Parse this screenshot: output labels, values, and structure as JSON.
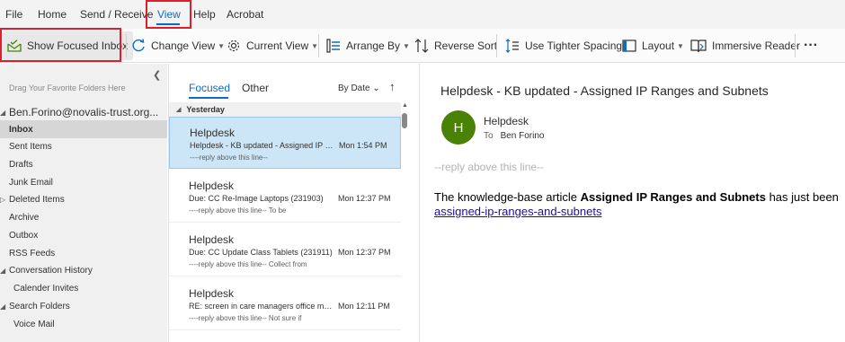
{
  "menu": {
    "items": [
      "File",
      "Home",
      "Send / Receive",
      "View",
      "Help",
      "Acrobat"
    ],
    "active": "View"
  },
  "ribbon": {
    "show_focused_inbox": "Show Focused Inbox",
    "change_view": "Change View",
    "current_view": "Current View",
    "arrange_by": "Arrange By",
    "reverse_sort": "Reverse Sort",
    "tighter_spacing": "Use Tighter Spacing",
    "layout": "Layout",
    "immersive_reader": "Immersive Reader",
    "more": "···"
  },
  "folders": {
    "favorites_hint": "Drag Your Favorite Folders Here",
    "account": "Ben.Forino@novalis-trust.org...",
    "items": [
      "Inbox",
      "Sent Items",
      "Drafts",
      "Junk Email",
      "Deleted Items",
      "Archive",
      "Outbox",
      "RSS Feeds",
      "Conversation History",
      "Calender Invites",
      "Search Folders",
      "Voice Mail"
    ],
    "selected": "Inbox"
  },
  "message_list": {
    "tab_focused": "Focused",
    "tab_other": "Other",
    "sort_label": "By Date",
    "group": "Yesterday",
    "messages": [
      {
        "from": "Helpdesk",
        "subject": "Helpdesk - KB updated - Assigned IP Ra...",
        "time": "Mon 1:54 PM",
        "preview": "----reply above this line--"
      },
      {
        "from": "Helpdesk",
        "subject": "Due: CC Re-Image Laptops (231903)",
        "time": "Mon 12:37 PM",
        "preview": "----reply above this line--  To be"
      },
      {
        "from": "Helpdesk",
        "subject": "Due: CC Update Class Tablets (231911)",
        "time": "Mon 12:37 PM",
        "preview": "----reply above this line--  Collect from"
      },
      {
        "from": "Helpdesk",
        "subject": "RE: screen in care managers office mul...",
        "time": "Mon 12:11 PM",
        "preview": "----reply above this line--  Not sure if"
      }
    ]
  },
  "reading": {
    "subject": "Helpdesk - KB updated - Assigned IP Ranges and Subnets",
    "avatar_letter": "H",
    "avatar_color": "#498205",
    "sender": "Helpdesk",
    "to_label": "To",
    "to_name": "Ben Forino",
    "reply_line": "--reply above this line--",
    "body_prefix": "The knowledge-base article ",
    "body_bold": "Assigned IP Ranges and Subnets",
    "body_suffix": " has just been",
    "link": "assigned-ip-ranges-and-subnets"
  },
  "colors": {
    "accent": "#0f6cbd",
    "highlight_box": "#e01e2b",
    "selected_message": "#cde6f7"
  }
}
